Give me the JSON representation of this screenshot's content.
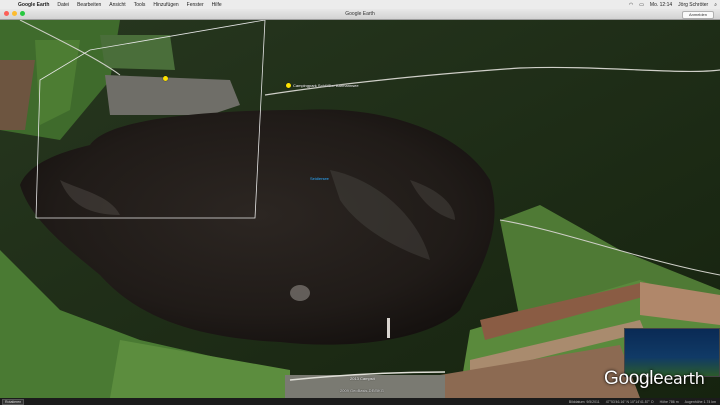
{
  "menubar": {
    "apple_glyph": "",
    "items": [
      "Google Earth",
      "Datei",
      "Bearbeiten",
      "Ansicht",
      "Tools",
      "Hinzufügen",
      "Fenster",
      "Hilfe"
    ],
    "clock": "Mo. 12:14",
    "user": "Jörg Schröter"
  },
  "window": {
    "title": "Google Earth",
    "toolbar_button": "Anmelden"
  },
  "map": {
    "placemarks": [
      {
        "label": ""
      },
      {
        "label": "Campingpark Schlüßler Bärmannsee"
      }
    ],
    "lake_label": "Seidlersee",
    "road_label": "2013 Campsit",
    "copyright": "2009 GeoBasis-DE/BKG"
  },
  "logo": {
    "google": "Google",
    "earth": "earth"
  },
  "statusbar": {
    "button": "Rotatieren",
    "date": "Bilddatum: 9/5/2011",
    "coords": "47°53'46.16\" N  10°14'41.57\" O",
    "elevation": "Höhe 786 m",
    "eye_alt": "Augenhöhe 1.74 km"
  },
  "colors": {
    "lake": "#1f1a17",
    "forest": "#1e2e1a",
    "field": "#4f7a35",
    "pin": "#ffe400"
  }
}
